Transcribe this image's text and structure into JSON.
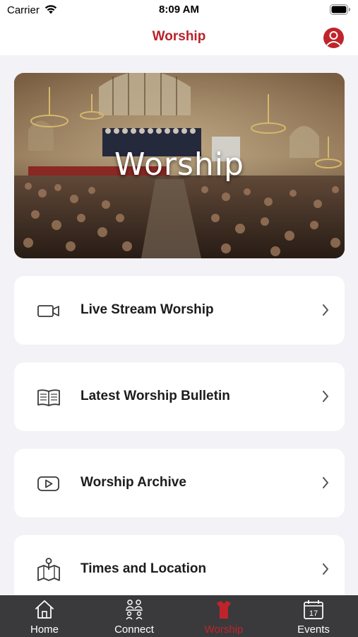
{
  "status_bar": {
    "carrier": "Carrier",
    "time": "8:09 AM"
  },
  "nav": {
    "title": "Worship"
  },
  "hero": {
    "title": "Worship"
  },
  "menu": [
    {
      "label": "Live Stream Worship",
      "icon": "video-camera-icon"
    },
    {
      "label": "Latest Worship Bulletin",
      "icon": "open-book-icon"
    },
    {
      "label": "Worship Archive",
      "icon": "play-video-icon"
    },
    {
      "label": "Times and Location",
      "icon": "map-pin-icon"
    }
  ],
  "tabs": [
    {
      "label": "Home",
      "icon": "home-icon"
    },
    {
      "label": "Connect",
      "icon": "people-icon"
    },
    {
      "label": "Worship",
      "icon": "robe-icon",
      "active": true
    },
    {
      "label": "Events",
      "icon": "calendar-icon",
      "calendar_day": "17"
    }
  ],
  "colors": {
    "accent": "#c0242b",
    "tab_bar": "#3a3a3c",
    "background": "#f2f2f7"
  }
}
